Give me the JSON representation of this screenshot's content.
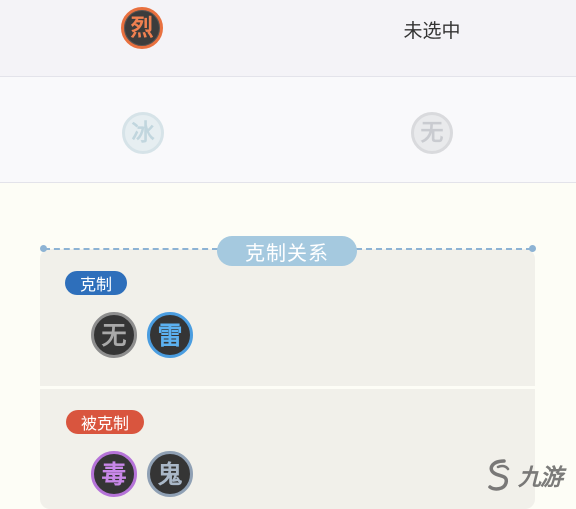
{
  "row1": {
    "element_badge": "烈",
    "status_text": "未选中"
  },
  "row2": {
    "badge_left": "冰",
    "badge_right": "无"
  },
  "section": {
    "title": "克制关系"
  },
  "counters": {
    "label": "克制",
    "badges": [
      "无",
      "雷"
    ]
  },
  "countered_by": {
    "label": "被克制",
    "badges": [
      "毒",
      "鬼"
    ]
  },
  "watermark": {
    "text": "九游"
  },
  "colors": {
    "counter_tag": "#2e6fbb",
    "countered_tag": "#d9553e",
    "section_pill": "#a5c9df"
  }
}
